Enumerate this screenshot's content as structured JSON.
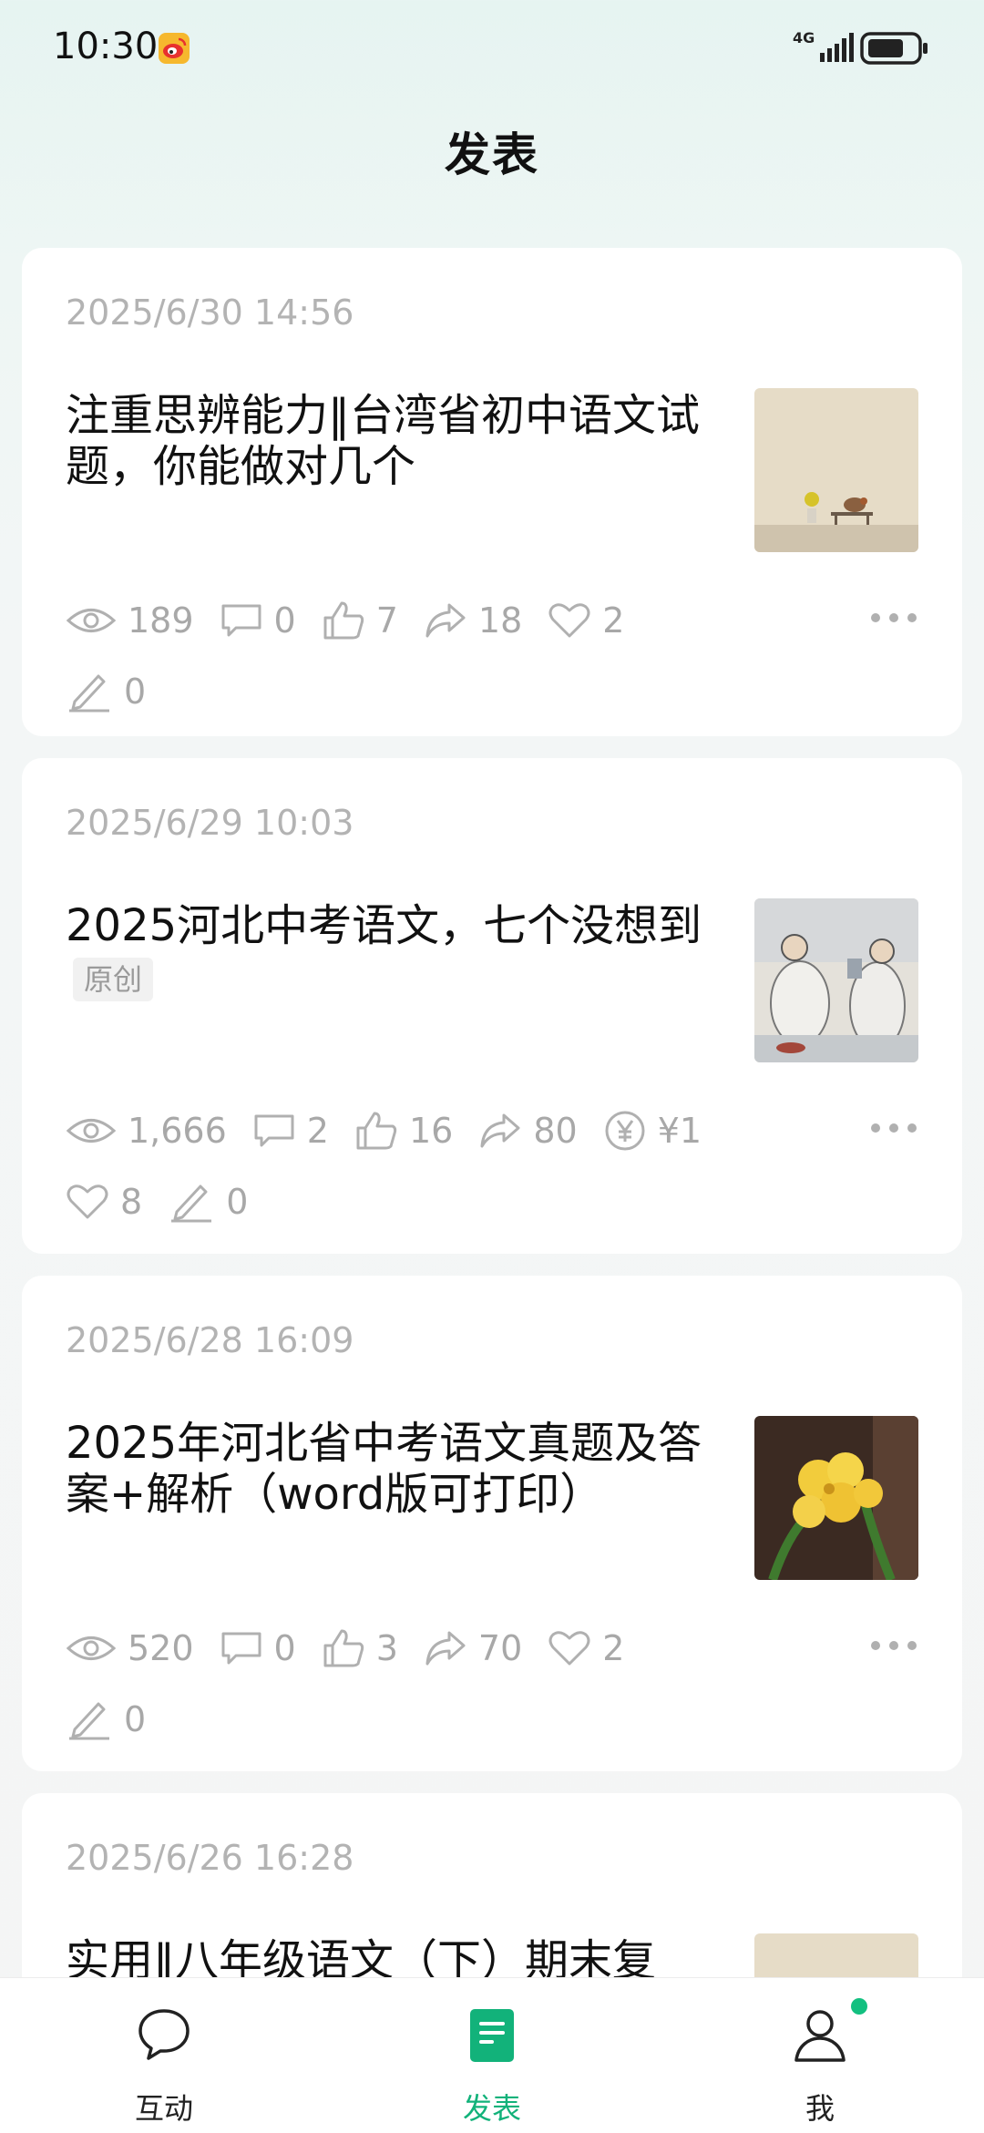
{
  "status_bar": {
    "time": "10:30",
    "network": "4G"
  },
  "header": {
    "title": "发表"
  },
  "articles": [
    {
      "date": "2025/6/30 14:56",
      "title": "注重思辨能力‖台湾省初中语文试题，你能做对几个",
      "thumbnail": "bird-on-bench-image",
      "stats": {
        "views": "189",
        "comments": "0",
        "likes": "7",
        "shares": "18",
        "favorites": "2",
        "notes": "0"
      }
    },
    {
      "date": "2025/6/29 10:03",
      "title": "2025河北中考语文，七个没想到",
      "tag": "原创",
      "thumbnail": "scholars-ink-painting-image",
      "stats": {
        "views": "1,666",
        "comments": "2",
        "likes": "16",
        "shares": "80",
        "reward": "¥1",
        "favorites": "8",
        "notes": "0"
      }
    },
    {
      "date": "2025/6/28 16:09",
      "title": "2025年河北省中考语文真题及答案+解析（word版可打印）",
      "thumbnail": "yellow-flowers-image",
      "stats": {
        "views": "520",
        "comments": "0",
        "likes": "3",
        "shares": "70",
        "favorites": "2",
        "notes": "0"
      }
    },
    {
      "date": "2025/6/26 16:28",
      "title": "实用‖八年级语文（下）期末复",
      "thumbnail": "beige-image"
    }
  ],
  "bottom_nav": {
    "items": [
      {
        "label": "互动",
        "icon": "chat-bubble-icon"
      },
      {
        "label": "发表",
        "icon": "document-icon",
        "active": true
      },
      {
        "label": "我",
        "icon": "person-icon"
      }
    ]
  },
  "colors": {
    "accent": "#12b27a",
    "muted": "#a8a8a8",
    "date": "#b3b3b3"
  }
}
